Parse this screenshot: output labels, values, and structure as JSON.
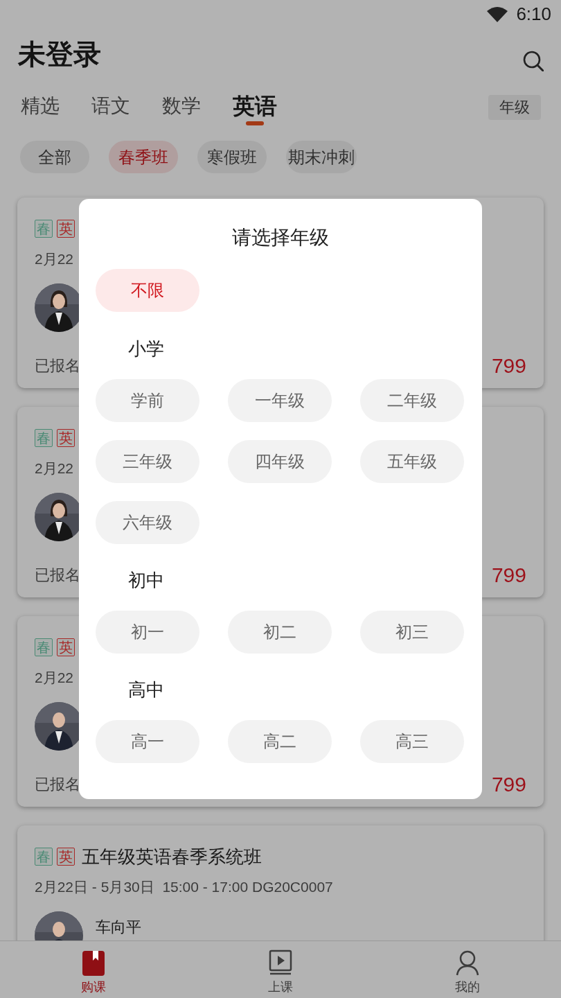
{
  "status_bar": {
    "time": "6:10"
  },
  "header": {
    "title": "未登录"
  },
  "subject_tabs": [
    {
      "label": "精选",
      "selected": false
    },
    {
      "label": "语文",
      "selected": false
    },
    {
      "label": "数学",
      "selected": false
    },
    {
      "label": "英语",
      "selected": true
    }
  ],
  "grade_button": "年级",
  "filter_chips": [
    {
      "label": "全部",
      "selected": false
    },
    {
      "label": "春季班",
      "selected": true
    },
    {
      "label": "寒假班",
      "selected": false
    },
    {
      "label": "期末冲刺",
      "selected": false
    }
  ],
  "courses": [
    {
      "tags": [
        {
          "label": "春",
          "color": "#4a8a74"
        },
        {
          "label": "英",
          "color": "#a82828"
        }
      ],
      "schedule": "2月22",
      "enrolled": "已报名",
      "price": "799"
    },
    {
      "tags": [
        {
          "label": "春",
          "color": "#4a8a74"
        },
        {
          "label": "英",
          "color": "#a82828"
        }
      ],
      "schedule": "2月22",
      "enrolled": "已报名",
      "price": "799"
    },
    {
      "tags": [
        {
          "label": "春",
          "color": "#4a8a74"
        },
        {
          "label": "英",
          "color": "#a82828"
        }
      ],
      "schedule": "2月22",
      "enrolled": "已报名",
      "price": "799"
    },
    {
      "tags": [
        {
          "label": "春",
          "color": "#4a8a74"
        },
        {
          "label": "英",
          "color": "#a82828"
        }
      ],
      "title": "五年级英语春季系统班",
      "schedule": "2月22日 - 5月30日  15:00 - 17:00 DG20C0007",
      "teacher": "车向平"
    }
  ],
  "grade_dialog": {
    "title": "请选择年级",
    "any": {
      "label": "不限",
      "selected": true
    },
    "sections": [
      {
        "heading": "小学",
        "grades": [
          {
            "label": "学前",
            "selected": false
          },
          {
            "label": "一年级",
            "selected": false
          },
          {
            "label": "二年级",
            "selected": false
          },
          {
            "label": "三年级",
            "selected": false
          },
          {
            "label": "四年级",
            "selected": false
          },
          {
            "label": "五年级",
            "selected": false
          },
          {
            "label": "六年级",
            "selected": false
          }
        ]
      },
      {
        "heading": "初中",
        "grades": [
          {
            "label": "初一",
            "selected": false
          },
          {
            "label": "初二",
            "selected": false
          },
          {
            "label": "初三",
            "selected": false
          }
        ]
      },
      {
        "heading": "高中",
        "grades": [
          {
            "label": "高一",
            "selected": false
          },
          {
            "label": "高二",
            "selected": false
          },
          {
            "label": "高三",
            "selected": false
          }
        ]
      }
    ]
  },
  "bottom_nav": [
    {
      "kind": "shop",
      "label": "购课",
      "selected": true
    },
    {
      "kind": "lesson",
      "label": "上课",
      "selected": false
    },
    {
      "kind": "me",
      "label": "我的",
      "selected": false
    }
  ]
}
